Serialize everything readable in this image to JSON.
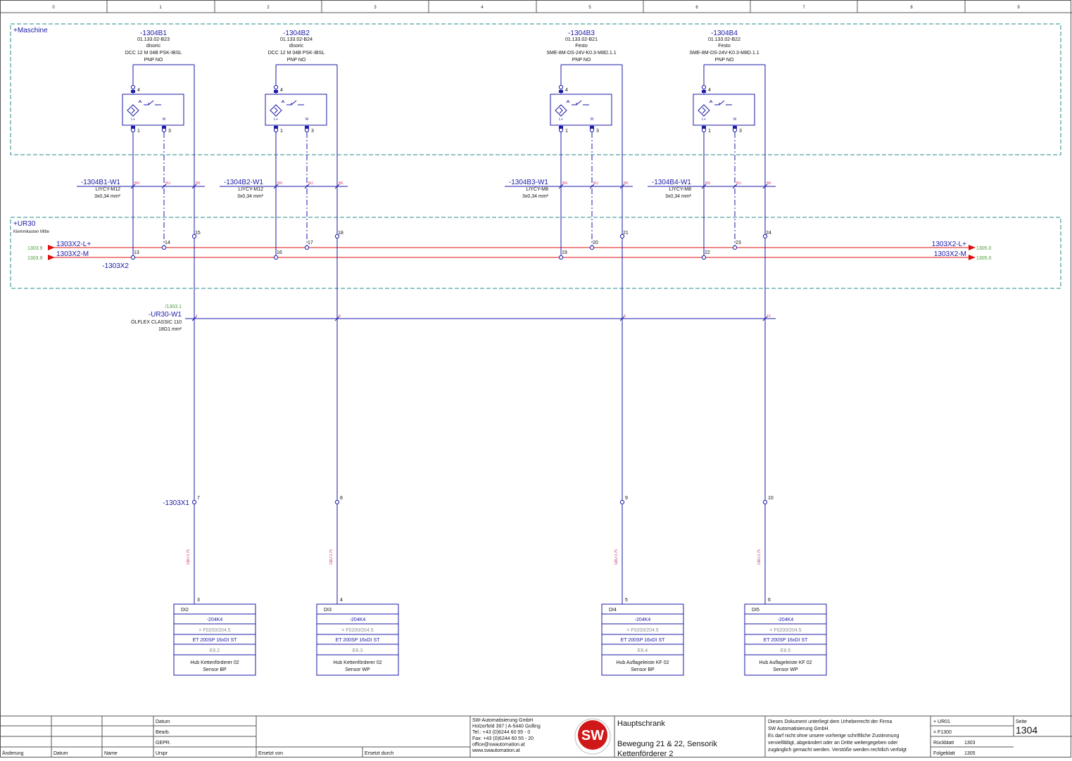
{
  "column_numbers": [
    "0",
    "1",
    "2",
    "3",
    "4",
    "5",
    "6",
    "7",
    "8",
    "9"
  ],
  "locations": {
    "maschine": "+Maschine",
    "ur30": "+UR30",
    "ur30_desc": "Klemmkasten Mitte"
  },
  "sensors": [
    {
      "tag": "-1304B1",
      "part": "01.133.02-B23",
      "maker": "disoric",
      "type": "DCC 12 M 04B PSK-IBSL",
      "func": "PNP NO",
      "cable": {
        "tag": "-1304B1-W1",
        "type": "LIYCY-M12",
        "size": "3x0,34 mm²"
      },
      "term_bn": "13",
      "term_bu": "14",
      "term_bk": "15",
      "x1": "7",
      "di_term": "3",
      "di": {
        "name": "DI2",
        "dev": "-204K4",
        "loc": "= F0200/204.5",
        "mod": "ET 200SP 16xDI ST",
        "addr": "E6.2",
        "desc1": "Hub Kettenförderer 02",
        "desc2": "Sensor BP"
      }
    },
    {
      "tag": "-1304B2",
      "part": "01.133.02-B24",
      "maker": "disoric",
      "type": "DCC 12 M 04B PSK-IBSL",
      "func": "PNP NO",
      "cable": {
        "tag": "-1304B2-W1",
        "type": "LIYCY-M12",
        "size": "3x0,34 mm²"
      },
      "term_bn": "16",
      "term_bu": "17",
      "term_bk": "18",
      "x1": "8",
      "di_term": "4",
      "di": {
        "name": "DI3",
        "dev": "-204K4",
        "loc": "= F0200/204.5",
        "mod": "ET 200SP 16xDI ST",
        "addr": "E6.3",
        "desc1": "Hub Kettenförderer 02",
        "desc2": "Sensor WP"
      }
    },
    {
      "tag": "-1304B3",
      "part": "01.133.02-B21",
      "maker": "Festo",
      "type": "SME-8M-DS-24V-K0.3-M8D.1.1",
      "func": "PNP NO",
      "cable": {
        "tag": "-1304B3-W1",
        "type": "LIYCY-M8",
        "size": "3x0,34 mm²"
      },
      "term_bn": "19",
      "term_bu": "20",
      "term_bk": "21",
      "x1": "9",
      "di_term": "5",
      "di": {
        "name": "DI4",
        "dev": "-204K4",
        "loc": "= F0200/204.5",
        "mod": "ET 200SP 16xDI ST",
        "addr": "E6.4",
        "desc1": "Hub Auflageleiste KF 02",
        "desc2": "Sensor BP"
      }
    },
    {
      "tag": "-1304B4",
      "part": "01.133.02-B22",
      "maker": "Festo",
      "type": "SME-8M-DS-24V-K0.3-M8D.1.1",
      "func": "PNP NO",
      "cable": {
        "tag": "-1304B4-W1",
        "type": "LIYCY-M8",
        "size": "3x0,34 mm²"
      },
      "term_bn": "22",
      "term_bu": "23",
      "term_bk": "24",
      "x1": "10",
      "di_term": "6",
      "di": {
        "name": "DI5",
        "dev": "-204K4",
        "loc": "= F0200/204.5",
        "mod": "ET 200SP 16xDI ST",
        "addr": "E6.5",
        "desc1": "Hub Auflageleiste KF 02",
        "desc2": "Sensor WP"
      }
    }
  ],
  "pins": {
    "p4": "4",
    "p1": "1",
    "p3": "3",
    "l_plus": "L+",
    "m": "M"
  },
  "wire_colors": {
    "bn": "BN",
    "bu": "BU",
    "bk": "BK"
  },
  "rails": {
    "lplus": "1303X2-L+",
    "m": "1303X2-M",
    "src_lplus": "1303.9",
    "src_m": "1303.9",
    "dst_lplus": "1305.0",
    "dst_m": "1305.0",
    "strip": "-1303X2"
  },
  "main_cable": {
    "ref": "/1303.1",
    "tag": "-UR30-W1",
    "type": "ÖLFLEX CLASSIC 110",
    "size": "18G1 mm²",
    "cores": [
      "7",
      "8",
      "9",
      "10"
    ]
  },
  "x1_strip": "-1303X1",
  "wire_label": "GBU 0,75",
  "title_block": {
    "rev_labels": {
      "date": "Datum",
      "edit": "Bearb.",
      "check": "GEPR."
    },
    "footer": {
      "change": "Änderung",
      "date": "Datum",
      "name": "Name",
      "orig": "Urspr",
      "replaced_from": "Ersetzt von",
      "replaced_by": "Ersetzt durch"
    },
    "company": [
      "SW-Automatisierung GmbH",
      "Holzerfeld 397 | A-5440 Golling",
      "Tel.: +43 (0)6244 60 55 - 0",
      "Fax: +43 (0)6244 60 55 - 20",
      "office@swautomation.at",
      "www.swautomation.at"
    ],
    "logo": "SW",
    "title": "Hauptschrank",
    "subtitle1": "Bewegung 21 & 22, Sensorik",
    "subtitle2": "Kettenförderer 2",
    "copyright": [
      "Dieses Dokument unterliegt dem Urheberrecht der Firma",
      "SW Automatisierung GmbH.",
      "Es darf nicht ohne unsere vorherige schriftliche Zustimmung",
      "vervielfältigt, abgeändert oder an Dritte weitergegeben oder",
      "zugänglich gemacht werden. Verstöße werden rechtlich verfolgt"
    ],
    "loc": "+ UR01",
    "func": "= F1300",
    "prev_label": "Rückblatt",
    "prev": "1303",
    "next_label": "Folgeblatt",
    "next": "1305",
    "page_label": "Seite",
    "page": "1304"
  },
  "colors": {
    "blue": "#1a1aa8",
    "red": "#e01010",
    "green": "#4a9a3a",
    "dash": "#2a8a8a",
    "pink": "#d04070"
  }
}
